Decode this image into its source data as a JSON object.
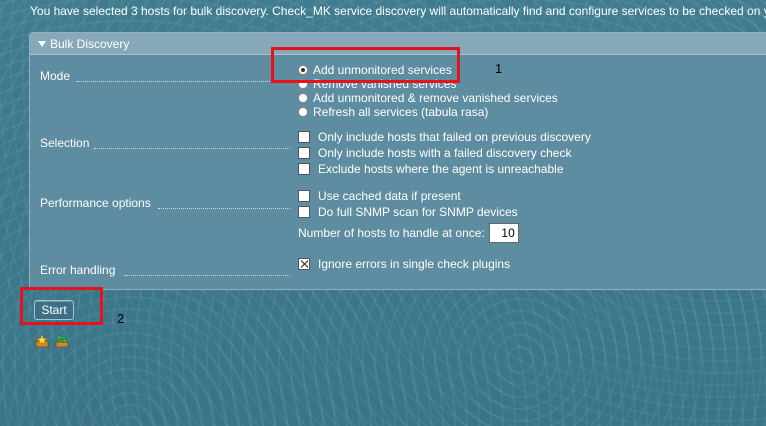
{
  "info_text": "You have selected 3 hosts for bulk discovery. Check_MK service discovery will automatically find and configure services to be checked on y",
  "panel": {
    "title": "Bulk Discovery",
    "mode": {
      "label": "Mode",
      "options": [
        {
          "label": "Add unmonitored services",
          "selected": true
        },
        {
          "label": "Remove vanished services",
          "selected": false
        },
        {
          "label": "Add unmonitored & remove vanished services",
          "selected": false
        },
        {
          "label": "Refresh all services (tabula rasa)",
          "selected": false
        }
      ]
    },
    "selection": {
      "label": "Selection",
      "options": [
        {
          "label": "Only include hosts that failed on previous discovery",
          "checked": false
        },
        {
          "label": "Only include hosts with a failed discovery check",
          "checked": false
        },
        {
          "label": "Exclude hosts where the agent is unreachable",
          "checked": false
        }
      ]
    },
    "performance": {
      "label": "Performance options",
      "options": [
        {
          "label": "Use cached data if present",
          "checked": false
        },
        {
          "label": "Do full SNMP scan for SNMP devices",
          "checked": false
        }
      ],
      "hosts_label": "Number of hosts to handle at once:",
      "hosts_value": "10"
    },
    "error_handling": {
      "label": "Error handling",
      "option": {
        "label": "Ignore errors in single check plugins",
        "checked": true
      }
    }
  },
  "start_button": "Start",
  "annotations": {
    "one": "1",
    "two": "2"
  },
  "icons": [
    "folder-star-icon",
    "refresh-arrows-icon"
  ],
  "colors": {
    "highlight": "#e8121a",
    "background": "#3f7c8f"
  }
}
